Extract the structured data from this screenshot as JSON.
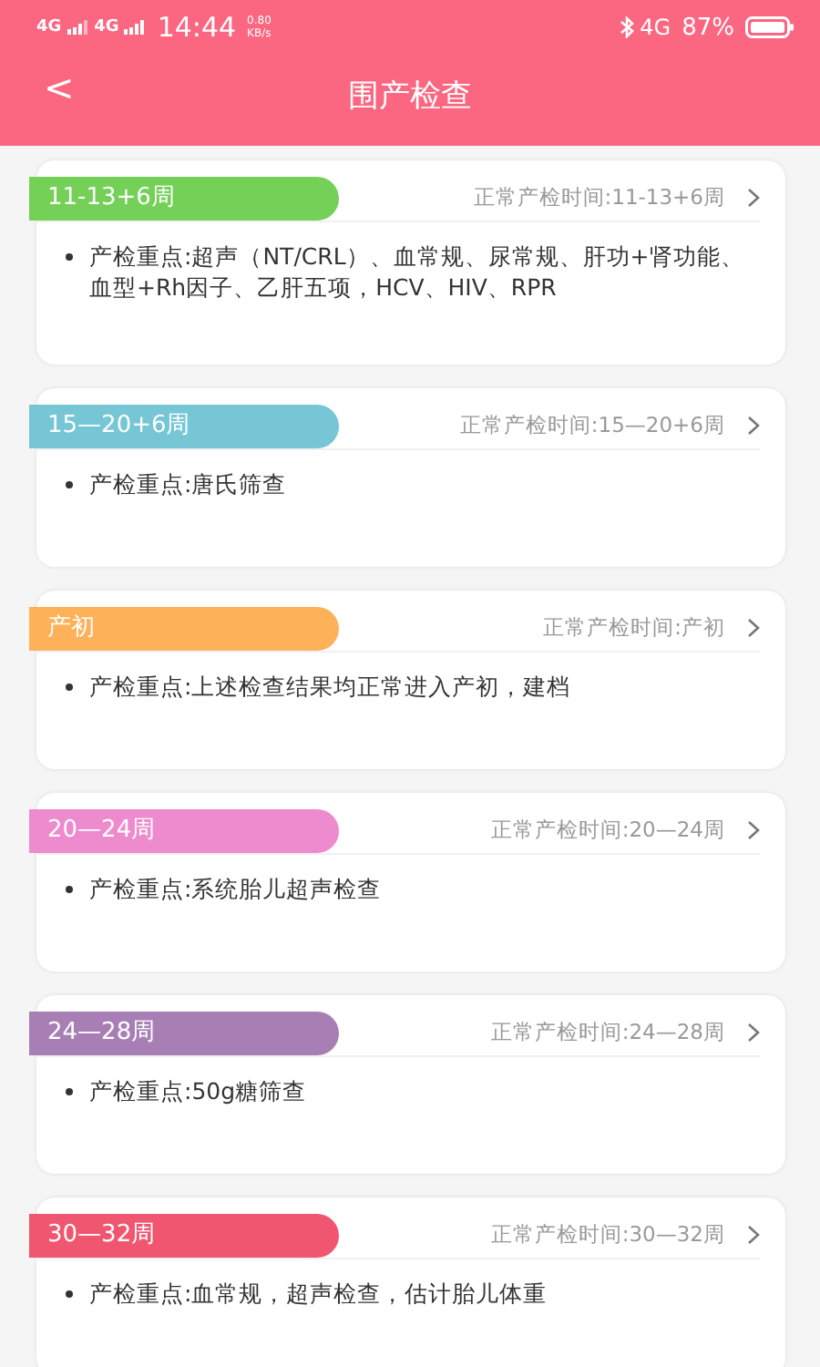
{
  "status_bar": {
    "network_1": "4G",
    "network_2": "4G",
    "time": "14:44",
    "speed": "0.80",
    "speed_unit": "KB/s",
    "network_3": "4G",
    "battery": "87%"
  },
  "header": {
    "back": "<",
    "title": "围产检查"
  },
  "cards": [
    {
      "period": "11-13+6周",
      "color": "#74d057",
      "normal_time": "正常产检时间:11-13+6周",
      "focus": "产检重点:超声（NT/CRL）、血常规、尿常规、肝功+肾功能、血型+Rh因子、乙肝五项，HCV、HIV、RPR"
    },
    {
      "period": "15—20+6周",
      "color": "#77c6d6",
      "normal_time": "正常产检时间:15—20+6周",
      "focus": "产检重点:唐氏筛查"
    },
    {
      "period": "产初",
      "color": "#fdb25a",
      "normal_time": "正常产检时间:产初",
      "focus": "产检重点:上述检查结果均正常进入产初，建档"
    },
    {
      "period": "20—24周",
      "color": "#ee8bce",
      "normal_time": "正常产检时间:20—24周",
      "focus": "产检重点:系统胎儿超声检查"
    },
    {
      "period": "24—28周",
      "color": "#a77fb5",
      "normal_time": "正常产检时间:24—28周",
      "focus": "产检重点:50g糖筛查"
    },
    {
      "period": "30—32周",
      "color": "#f0566f",
      "normal_time": "正常产检时间:30—32周",
      "focus": "产检重点:血常规，超声检查，估计胎儿体重"
    }
  ]
}
